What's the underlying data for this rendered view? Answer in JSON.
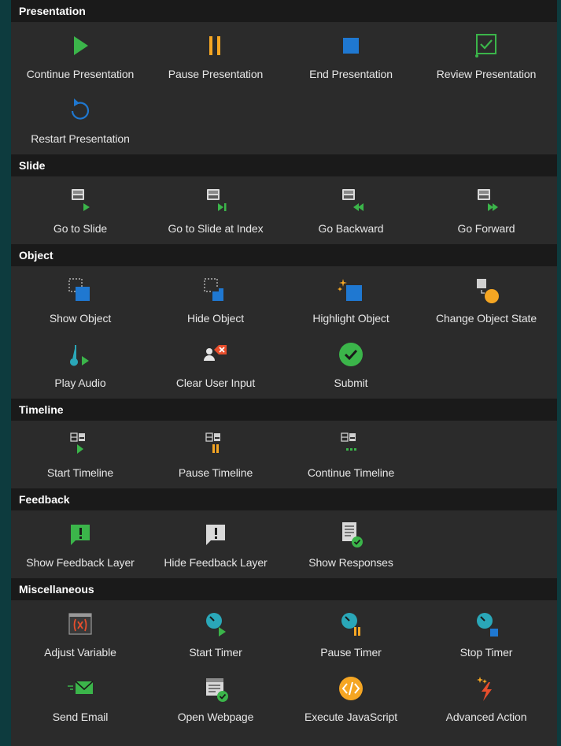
{
  "colors": {
    "background": "#0d3b3e",
    "panel": "#2b2b2b",
    "header": "#1a1a1a",
    "green": "#3bb54a",
    "orange": "#f5a623",
    "blue": "#1f78d1",
    "teal": "#2aa7b8",
    "red": "#e84e2c"
  },
  "sections": [
    {
      "title": "Presentation",
      "items": [
        {
          "label": "Continue Presentation",
          "icon": "play-icon"
        },
        {
          "label": "Pause Presentation",
          "icon": "pause-icon"
        },
        {
          "label": "End Presentation",
          "icon": "stop-icon"
        },
        {
          "label": "Review Presentation",
          "icon": "review-checkbox-icon"
        },
        {
          "label": "Restart Presentation",
          "icon": "restart-icon"
        }
      ]
    },
    {
      "title": "Slide",
      "items": [
        {
          "label": "Go to Slide",
          "icon": "slide-play-icon"
        },
        {
          "label": "Go to Slide at Index",
          "icon": "slide-index-icon"
        },
        {
          "label": "Go Backward",
          "icon": "slide-backward-icon"
        },
        {
          "label": "Go Forward",
          "icon": "slide-forward-icon"
        }
      ]
    },
    {
      "title": "Object",
      "items": [
        {
          "label": "Show Object",
          "icon": "show-object-icon"
        },
        {
          "label": "Hide Object",
          "icon": "hide-object-icon"
        },
        {
          "label": "Highlight Object",
          "icon": "highlight-object-icon"
        },
        {
          "label": "Change Object State",
          "icon": "change-state-icon"
        },
        {
          "label": "Play Audio",
          "icon": "play-audio-icon"
        },
        {
          "label": "Clear User Input",
          "icon": "clear-input-icon"
        },
        {
          "label": "Submit",
          "icon": "submit-check-icon"
        }
      ]
    },
    {
      "title": "Timeline",
      "items": [
        {
          "label": "Start Timeline",
          "icon": "timeline-start-icon"
        },
        {
          "label": "Pause Timeline",
          "icon": "timeline-pause-icon"
        },
        {
          "label": "Continue Timeline",
          "icon": "timeline-continue-icon"
        }
      ]
    },
    {
      "title": "Feedback",
      "items": [
        {
          "label": "Show Feedback Layer",
          "icon": "show-feedback-icon"
        },
        {
          "label": "Hide Feedback Layer",
          "icon": "hide-feedback-icon"
        },
        {
          "label": "Show Responses",
          "icon": "show-responses-icon"
        }
      ]
    },
    {
      "title": "Miscellaneous",
      "items": [
        {
          "label": "Adjust Variable",
          "icon": "variable-icon"
        },
        {
          "label": "Start Timer",
          "icon": "timer-start-icon"
        },
        {
          "label": "Pause Timer",
          "icon": "timer-pause-icon"
        },
        {
          "label": "Stop Timer",
          "icon": "timer-stop-icon"
        },
        {
          "label": "Send Email",
          "icon": "email-icon"
        },
        {
          "label": "Open Webpage",
          "icon": "webpage-icon"
        },
        {
          "label": "Execute JavaScript",
          "icon": "javascript-icon"
        },
        {
          "label": "Advanced Action",
          "icon": "advanced-action-icon"
        }
      ]
    }
  ]
}
